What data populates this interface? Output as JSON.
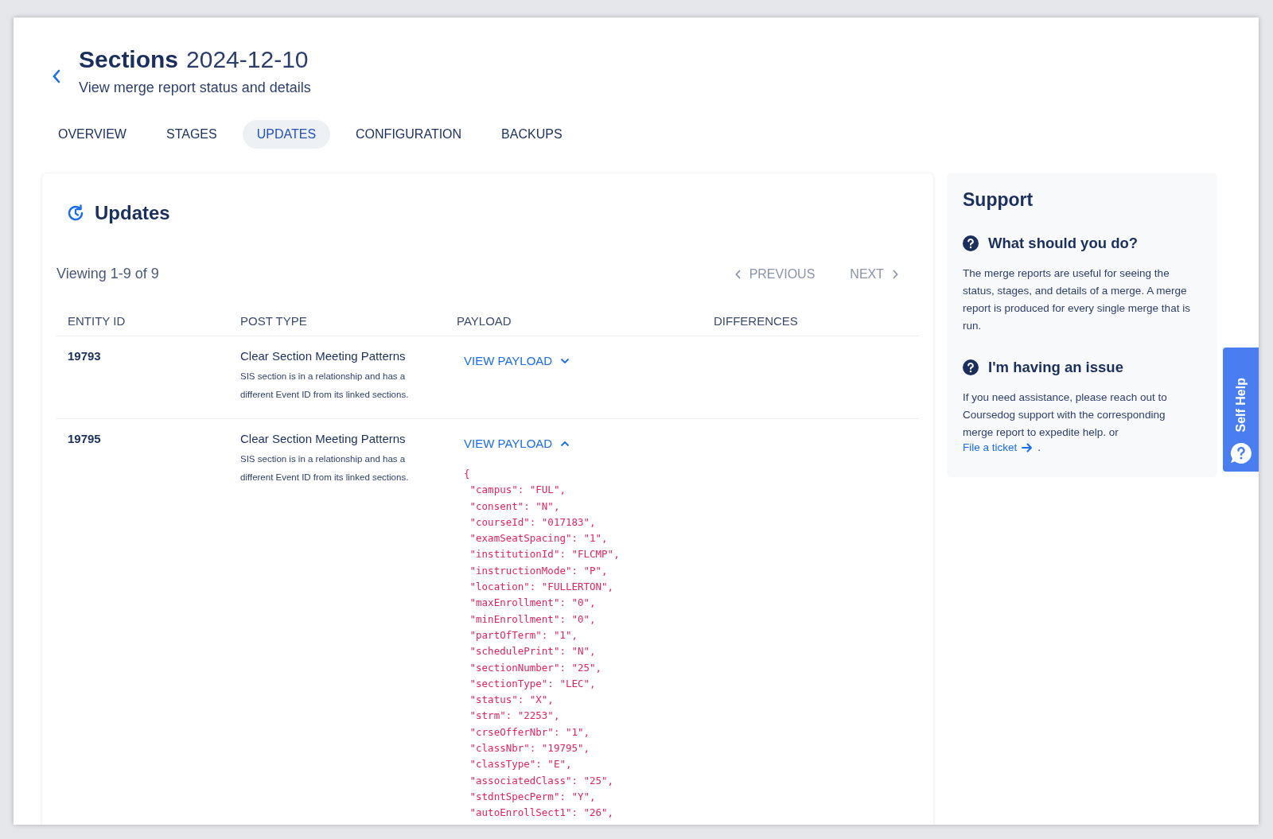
{
  "header": {
    "title": "Sections",
    "date": "2024-12-10",
    "subtitle": "View merge report status and details"
  },
  "tabs": [
    {
      "label": "OVERVIEW",
      "selected": false
    },
    {
      "label": "STAGES",
      "selected": false
    },
    {
      "label": "UPDATES",
      "selected": true
    },
    {
      "label": "CONFIGURATION",
      "selected": false
    },
    {
      "label": "BACKUPS",
      "selected": false
    }
  ],
  "updates": {
    "title": "Updates",
    "viewing": "Viewing 1-9 of 9",
    "previous": "PREVIOUS",
    "next": "NEXT",
    "columns": [
      "ENTITY ID",
      "POST TYPE",
      "PAYLOAD",
      "DIFFERENCES"
    ],
    "rows": [
      {
        "entity_id": "19793",
        "post_type": "Clear Section Meeting Patterns",
        "note": "SIS section is in a relationship and has a different Event ID from its linked sections.",
        "payload_link": "VIEW PAYLOAD",
        "expanded": false,
        "payload": []
      },
      {
        "entity_id": "19795",
        "post_type": "Clear Section Meeting Patterns",
        "note": "SIS section is in a relationship and has a different Event ID from its linked sections.",
        "payload_link": "VIEW PAYLOAD",
        "expanded": true,
        "payload": [
          "{",
          " \"campus\": \"FUL\",",
          " \"consent\": \"N\",",
          " \"courseId\": \"017183\",",
          " \"examSeatSpacing\": \"1\",",
          " \"institutionId\": \"FLCMP\",",
          " \"instructionMode\": \"P\",",
          " \"location\": \"FULLERTON\",",
          " \"maxEnrollment\": \"0\",",
          " \"minEnrollment\": \"0\",",
          " \"partOfTerm\": \"1\",",
          " \"schedulePrint\": \"N\",",
          " \"sectionNumber\": \"25\",",
          " \"sectionType\": \"LEC\",",
          " \"status\": \"X\",",
          " \"strm\": \"2253\",",
          " \"crseOfferNbr\": \"1\",",
          " \"classNbr\": \"19795\",",
          " \"classType\": \"E\",",
          " \"associatedClass\": \"25\",",
          " \"stdntSpecPerm\": \"Y\",",
          " \"autoEnrollSect1\": \"26\","
        ]
      }
    ]
  },
  "support": {
    "title": "Support",
    "sections": [
      {
        "heading": "What should you do?",
        "text": "The merge reports are useful for seeing the status, stages, and details of a merge. A merge report is produced for every single merge that is run."
      },
      {
        "heading": "I'm having an issue",
        "text": "If you need assistance, please reach out to Coursedog support with the corresponding merge report to expedite help. or",
        "link": "File a ticket",
        "after": "."
      }
    ]
  },
  "self_help": "Self Help"
}
